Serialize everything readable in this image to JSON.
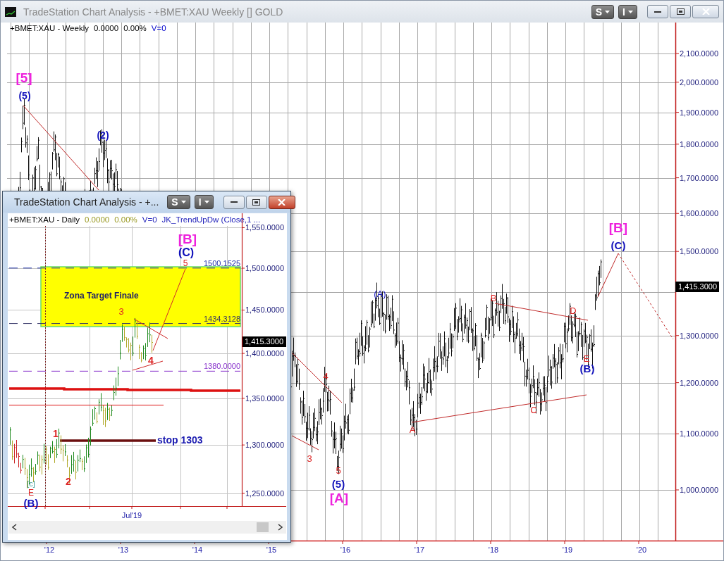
{
  "main_window": {
    "title": "TradeStation Chart Analysis - +BMET:XAU Weekly [] GOLD",
    "tool_buttons": [
      "S",
      "I"
    ],
    "legend": [
      "+BMET:XAU - Weekly",
      "0.0000",
      "0.00%",
      "V=0"
    ],
    "price_axis": [
      "2,100.0000",
      "2,000.0000",
      "1,900.0000",
      "1,800.0000",
      "1,700.0000",
      "1,600.0000",
      "1,500.0000",
      "1,300.0000",
      "1,200.0000",
      "1,100.0000",
      "1,000.0000"
    ],
    "last_price": "1,415.3000",
    "time_axis": [
      "'12",
      "'13",
      "'14",
      "'15",
      "'16",
      "'17",
      "'18",
      "'19",
      "'20"
    ],
    "wave_labels": [
      {
        "text": "[5]",
        "color": "#ee22dd"
      },
      {
        "text": "(5)",
        "color": "#1111bb"
      },
      {
        "text": "(2)",
        "color": "#1111bb"
      },
      {
        "text": "(A)",
        "color": "#1111bb"
      },
      {
        "text": "B",
        "color": "#dd2222"
      },
      {
        "text": "D",
        "color": "#dd2222"
      },
      {
        "text": "E",
        "color": "#dd2222"
      },
      {
        "text": "(B)",
        "color": "#1111bb"
      },
      {
        "text": "C",
        "color": "#dd2222"
      },
      {
        "text": "A",
        "color": "#dd2222"
      },
      {
        "text": "4",
        "color": "#dd2222"
      },
      {
        "text": "3",
        "color": "#dd2222"
      },
      {
        "text": "5",
        "color": "#dd2222"
      },
      {
        "text": "(5)",
        "color": "#1111bb"
      },
      {
        "text": "[A]",
        "color": "#ee22dd"
      },
      {
        "text": "[B]",
        "color": "#ee22dd"
      },
      {
        "text": "(C)",
        "color": "#1111bb"
      }
    ]
  },
  "inset_window": {
    "title": "TradeStation Chart Analysis - +...",
    "tool_buttons": [
      "S",
      "I"
    ],
    "legend": [
      "+BMET:XAU - Daily",
      "0.0000",
      "0.00%",
      "V=0",
      "JK_TrendUpDw (Close,1 ..."
    ],
    "price_axis": [
      "1,550.0000",
      "1,500.0000",
      "1,450.0000",
      "1,400.0000",
      "1,350.0000",
      "1,300.0000",
      "1,250.0000"
    ],
    "last_price": "1,415.3000",
    "levels": [
      {
        "text": "1500.1525",
        "color": "#2233aa"
      },
      {
        "text": "1434.3128",
        "color": "#333366"
      },
      {
        "text": "1380.0000",
        "color": "#8833cc"
      }
    ],
    "zone_label": "Zona Target Finale",
    "stop_label": "stop 1303",
    "wave_labels": [
      {
        "text": "[B]",
        "color": "#ee22dd"
      },
      {
        "text": "(C)",
        "color": "#1111bb"
      },
      {
        "text": "5",
        "color": "#dd2222"
      },
      {
        "text": "3",
        "color": "#dd2222"
      },
      {
        "text": "4",
        "color": "#dd2222"
      },
      {
        "text": "1",
        "color": "#dd2222"
      },
      {
        "text": "2",
        "color": "#dd2222"
      },
      {
        "text": "[c]",
        "color": "#339999"
      },
      {
        "text": "E",
        "color": "#dd2222"
      },
      {
        "text": "(B)",
        "color": "#1111bb"
      }
    ],
    "time_axis": [
      "Jul'19"
    ]
  }
}
